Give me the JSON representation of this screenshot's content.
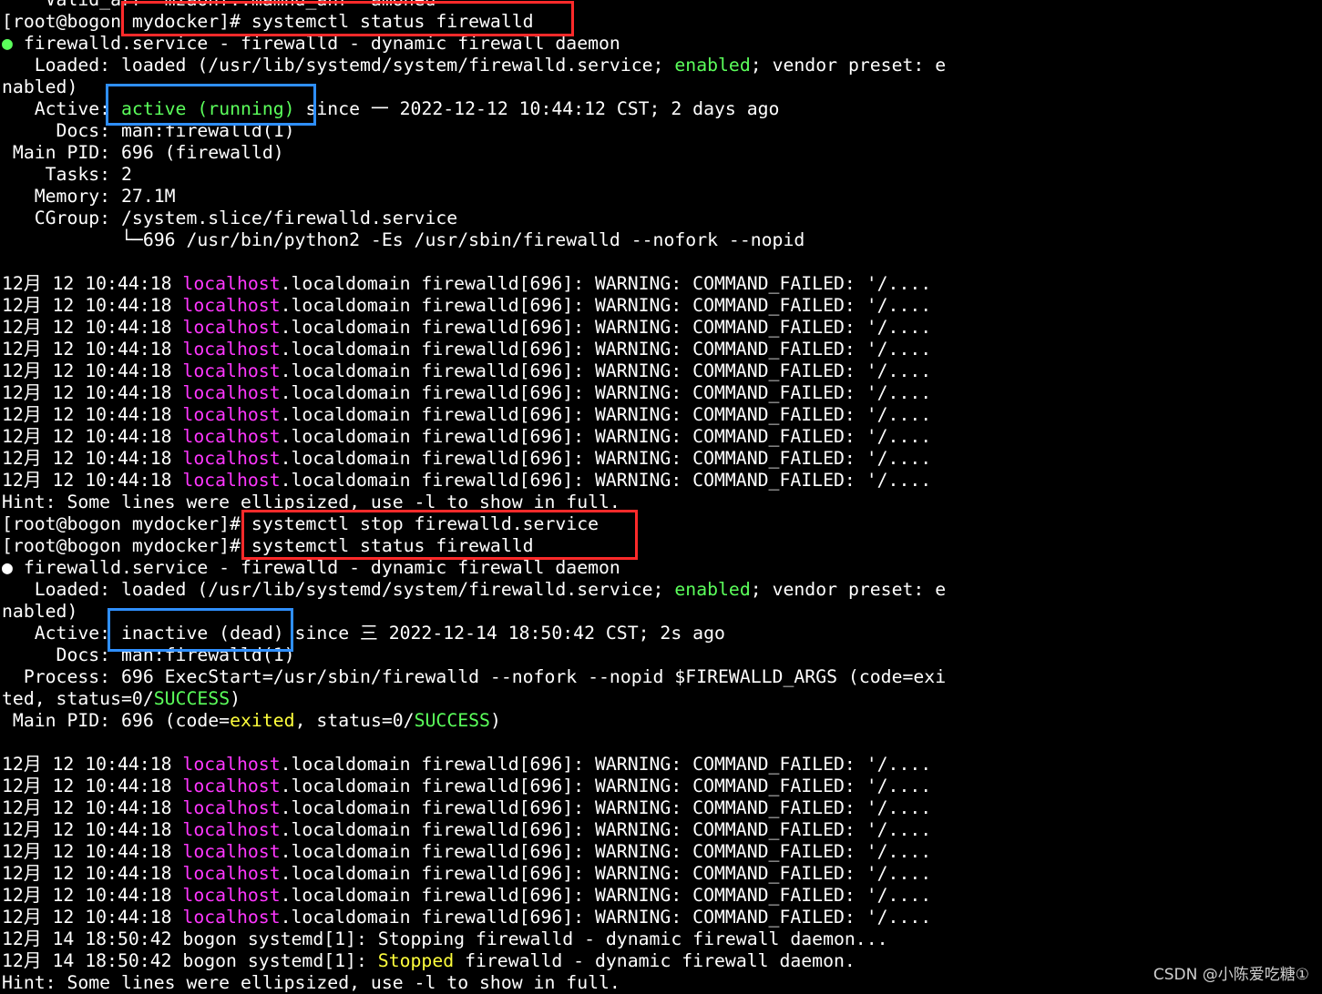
{
  "terminal": {
    "colors": {
      "background": "#000000",
      "text": "#ffffff",
      "green": "#5bff5b",
      "magenta": "#ff37ff",
      "yellow": "#ffff3c",
      "box_red": "#ff2a2a",
      "box_blue": "#2f8fff"
    },
    "lines": [
      {
        "segments": [
          {
            "t": "    Valid_arr  mzaonf..mamnd_anr  amoned",
            "c": "w"
          }
        ]
      },
      {
        "segments": [
          {
            "t": "[root@bogon mydocker]# systemctl status firewalld",
            "c": "w"
          }
        ]
      },
      {
        "segments": [
          {
            "t": "● firewalld.service - firewalld - dynamic firewall daemon",
            "c": "gdot"
          }
        ]
      },
      {
        "segments": [
          {
            "t": "   Loaded: loaded (/usr/lib/systemd/system/firewalld.service; ",
            "c": "w"
          },
          {
            "t": "enabled",
            "c": "g"
          },
          {
            "t": "; vendor preset: e",
            "c": "w"
          }
        ]
      },
      {
        "segments": [
          {
            "t": "nabled)",
            "c": "w"
          }
        ]
      },
      {
        "segments": [
          {
            "t": "   Active: ",
            "c": "w"
          },
          {
            "t": "active (running)",
            "c": "g"
          },
          {
            "t": " since 一 2022-12-12 10:44:12 CST; 2 days ago",
            "c": "w"
          }
        ]
      },
      {
        "segments": [
          {
            "t": "     Docs: man:firewalld(1)",
            "c": "w"
          }
        ]
      },
      {
        "segments": [
          {
            "t": " Main PID: 696 (firewalld)",
            "c": "w"
          }
        ]
      },
      {
        "segments": [
          {
            "t": "    Tasks: 2",
            "c": "w"
          }
        ]
      },
      {
        "segments": [
          {
            "t": "   Memory: 27.1M",
            "c": "w"
          }
        ]
      },
      {
        "segments": [
          {
            "t": "   CGroup: /system.slice/firewalld.service",
            "c": "w"
          }
        ]
      },
      {
        "segments": [
          {
            "t": "           └─696 /usr/bin/python2 -Es /usr/sbin/firewalld --nofork --nopid",
            "c": "w"
          }
        ]
      },
      {
        "segments": [
          {
            "t": "",
            "c": "w"
          }
        ]
      },
      {
        "segments": [
          {
            "t": "12月 12 10:44:18 ",
            "c": "w"
          },
          {
            "t": "localhost",
            "c": "m"
          },
          {
            "t": ".localdomain firewalld[696]: WARNING: COMMAND_FAILED: '/....",
            "c": "w"
          }
        ]
      },
      {
        "segments": [
          {
            "t": "12月 12 10:44:18 ",
            "c": "w"
          },
          {
            "t": "localhost",
            "c": "m"
          },
          {
            "t": ".localdomain firewalld[696]: WARNING: COMMAND_FAILED: '/....",
            "c": "w"
          }
        ]
      },
      {
        "segments": [
          {
            "t": "12月 12 10:44:18 ",
            "c": "w"
          },
          {
            "t": "localhost",
            "c": "m"
          },
          {
            "t": ".localdomain firewalld[696]: WARNING: COMMAND_FAILED: '/....",
            "c": "w"
          }
        ]
      },
      {
        "segments": [
          {
            "t": "12月 12 10:44:18 ",
            "c": "w"
          },
          {
            "t": "localhost",
            "c": "m"
          },
          {
            "t": ".localdomain firewalld[696]: WARNING: COMMAND_FAILED: '/....",
            "c": "w"
          }
        ]
      },
      {
        "segments": [
          {
            "t": "12月 12 10:44:18 ",
            "c": "w"
          },
          {
            "t": "localhost",
            "c": "m"
          },
          {
            "t": ".localdomain firewalld[696]: WARNING: COMMAND_FAILED: '/....",
            "c": "w"
          }
        ]
      },
      {
        "segments": [
          {
            "t": "12月 12 10:44:18 ",
            "c": "w"
          },
          {
            "t": "localhost",
            "c": "m"
          },
          {
            "t": ".localdomain firewalld[696]: WARNING: COMMAND_FAILED: '/....",
            "c": "w"
          }
        ]
      },
      {
        "segments": [
          {
            "t": "12月 12 10:44:18 ",
            "c": "w"
          },
          {
            "t": "localhost",
            "c": "m"
          },
          {
            "t": ".localdomain firewalld[696]: WARNING: COMMAND_FAILED: '/....",
            "c": "w"
          }
        ]
      },
      {
        "segments": [
          {
            "t": "12月 12 10:44:18 ",
            "c": "w"
          },
          {
            "t": "localhost",
            "c": "m"
          },
          {
            "t": ".localdomain firewalld[696]: WARNING: COMMAND_FAILED: '/....",
            "c": "w"
          }
        ]
      },
      {
        "segments": [
          {
            "t": "12月 12 10:44:18 ",
            "c": "w"
          },
          {
            "t": "localhost",
            "c": "m"
          },
          {
            "t": ".localdomain firewalld[696]: WARNING: COMMAND_FAILED: '/....",
            "c": "w"
          }
        ]
      },
      {
        "segments": [
          {
            "t": "12月 12 10:44:18 ",
            "c": "w"
          },
          {
            "t": "localhost",
            "c": "m"
          },
          {
            "t": ".localdomain firewalld[696]: WARNING: COMMAND_FAILED: '/....",
            "c": "w"
          }
        ]
      },
      {
        "segments": [
          {
            "t": "Hint: Some lines were ellipsized, use -l to show in full.",
            "c": "w"
          }
        ]
      },
      {
        "segments": [
          {
            "t": "[root@bogon mydocker]# systemctl stop firewalld.service",
            "c": "w"
          }
        ]
      },
      {
        "segments": [
          {
            "t": "[root@bogon mydocker]# systemctl status firewalld",
            "c": "w"
          }
        ]
      },
      {
        "segments": [
          {
            "t": "● firewalld.service - firewalld - dynamic firewall daemon",
            "c": "w"
          }
        ]
      },
      {
        "segments": [
          {
            "t": "   Loaded: loaded (/usr/lib/systemd/system/firewalld.service; ",
            "c": "w"
          },
          {
            "t": "enabled",
            "c": "g"
          },
          {
            "t": "; vendor preset: e",
            "c": "w"
          }
        ]
      },
      {
        "segments": [
          {
            "t": "nabled)",
            "c": "w"
          }
        ]
      },
      {
        "segments": [
          {
            "t": "   Active: inactive (dead) since 三 2022-12-14 18:50:42 CST; 2s ago",
            "c": "w"
          }
        ]
      },
      {
        "segments": [
          {
            "t": "     Docs: man:firewalld(1)",
            "c": "w"
          }
        ]
      },
      {
        "segments": [
          {
            "t": "  Process: 696 ExecStart=/usr/sbin/firewalld --nofork --nopid $FIREWALLD_ARGS (code=exi",
            "c": "w"
          }
        ]
      },
      {
        "segments": [
          {
            "t": "ted, status=0/",
            "c": "w"
          },
          {
            "t": "SUCCESS",
            "c": "g"
          },
          {
            "t": ")",
            "c": "w"
          }
        ]
      },
      {
        "segments": [
          {
            "t": " Main PID: 696 (code=",
            "c": "w"
          },
          {
            "t": "exited",
            "c": "y"
          },
          {
            "t": ", status=0/",
            "c": "w"
          },
          {
            "t": "SUCCESS",
            "c": "g"
          },
          {
            "t": ")",
            "c": "w"
          }
        ]
      },
      {
        "segments": [
          {
            "t": "",
            "c": "w"
          }
        ]
      },
      {
        "segments": [
          {
            "t": "12月 12 10:44:18 ",
            "c": "w"
          },
          {
            "t": "localhost",
            "c": "m"
          },
          {
            "t": ".localdomain firewalld[696]: WARNING: COMMAND_FAILED: '/....",
            "c": "w"
          }
        ]
      },
      {
        "segments": [
          {
            "t": "12月 12 10:44:18 ",
            "c": "w"
          },
          {
            "t": "localhost",
            "c": "m"
          },
          {
            "t": ".localdomain firewalld[696]: WARNING: COMMAND_FAILED: '/....",
            "c": "w"
          }
        ]
      },
      {
        "segments": [
          {
            "t": "12月 12 10:44:18 ",
            "c": "w"
          },
          {
            "t": "localhost",
            "c": "m"
          },
          {
            "t": ".localdomain firewalld[696]: WARNING: COMMAND_FAILED: '/....",
            "c": "w"
          }
        ]
      },
      {
        "segments": [
          {
            "t": "12月 12 10:44:18 ",
            "c": "w"
          },
          {
            "t": "localhost",
            "c": "m"
          },
          {
            "t": ".localdomain firewalld[696]: WARNING: COMMAND_FAILED: '/....",
            "c": "w"
          }
        ]
      },
      {
        "segments": [
          {
            "t": "12月 12 10:44:18 ",
            "c": "w"
          },
          {
            "t": "localhost",
            "c": "m"
          },
          {
            "t": ".localdomain firewalld[696]: WARNING: COMMAND_FAILED: '/....",
            "c": "w"
          }
        ]
      },
      {
        "segments": [
          {
            "t": "12月 12 10:44:18 ",
            "c": "w"
          },
          {
            "t": "localhost",
            "c": "m"
          },
          {
            "t": ".localdomain firewalld[696]: WARNING: COMMAND_FAILED: '/....",
            "c": "w"
          }
        ]
      },
      {
        "segments": [
          {
            "t": "12月 12 10:44:18 ",
            "c": "w"
          },
          {
            "t": "localhost",
            "c": "m"
          },
          {
            "t": ".localdomain firewalld[696]: WARNING: COMMAND_FAILED: '/....",
            "c": "w"
          }
        ]
      },
      {
        "segments": [
          {
            "t": "12月 12 10:44:18 ",
            "c": "w"
          },
          {
            "t": "localhost",
            "c": "m"
          },
          {
            "t": ".localdomain firewalld[696]: WARNING: COMMAND_FAILED: '/....",
            "c": "w"
          }
        ]
      },
      {
        "segments": [
          {
            "t": "12月 14 18:50:42 bogon systemd[1]: Stopping firewalld - dynamic firewall daemon...",
            "c": "w"
          }
        ]
      },
      {
        "segments": [
          {
            "t": "12月 14 18:50:42 bogon systemd[1]: ",
            "c": "w"
          },
          {
            "t": "Stopped",
            "c": "y"
          },
          {
            "t": " firewalld - dynamic firewall daemon.",
            "c": "w"
          }
        ]
      },
      {
        "segments": [
          {
            "t": "Hint: Some lines were ellipsized, use -l to show in full.",
            "c": "w"
          }
        ]
      }
    ]
  },
  "annotations": [
    {
      "name": "highlight-command-status-1",
      "color": "red"
    },
    {
      "name": "highlight-active-running",
      "color": "blue"
    },
    {
      "name": "highlight-commands-stop-status",
      "color": "red"
    },
    {
      "name": "highlight-inactive-dead",
      "color": "blue"
    }
  ],
  "watermark": {
    "text": "CSDN @小陈爱吃糖①"
  }
}
